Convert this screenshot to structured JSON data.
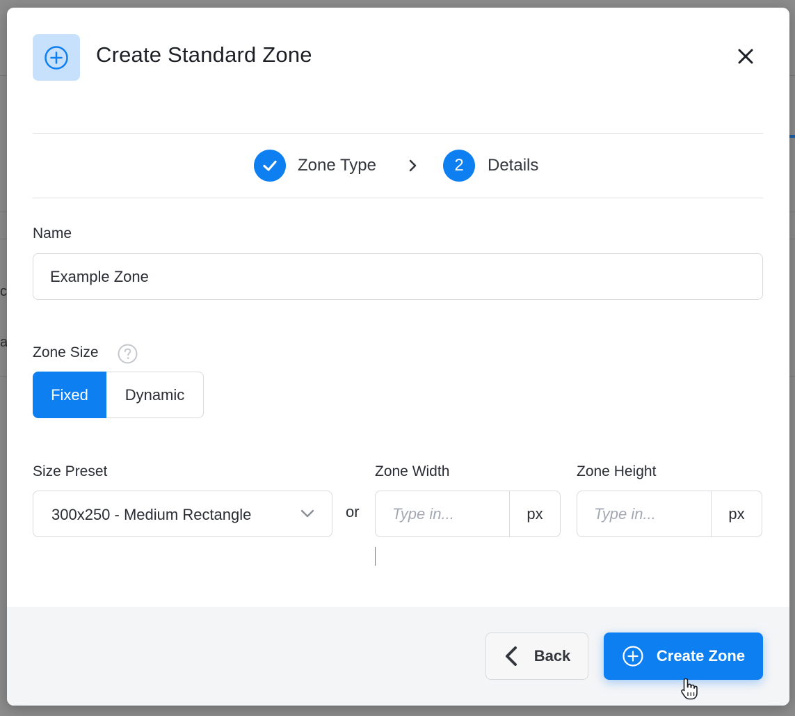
{
  "modal": {
    "title": "Create Standard Zone",
    "header_icon": "plus-circle-icon",
    "close_icon": "close-icon"
  },
  "stepper": {
    "steps": [
      {
        "label": "Zone Type",
        "state": "completed",
        "icon": "check-icon"
      },
      {
        "label": "Details",
        "state": "active",
        "number": "2"
      }
    ],
    "separator_icon": "chevron-right-icon"
  },
  "form": {
    "name_label": "Name",
    "name_value": "Example Zone",
    "zone_size_label": "Zone Size",
    "zone_size_help_icon": "question-circle-icon",
    "zone_size_options": [
      "Fixed",
      "Dynamic"
    ],
    "zone_size_selected": "Fixed",
    "size_preset_label": "Size Preset",
    "size_preset_value": "300x250 - Medium Rectangle",
    "or_text": "or",
    "zone_width_label": "Zone Width",
    "zone_width_placeholder": "Type in...",
    "zone_width_unit": "px",
    "zone_height_label": "Zone Height",
    "zone_height_placeholder": "Type in...",
    "zone_height_unit": "px"
  },
  "footer": {
    "back_label": "Back",
    "back_icon": "chevron-left-icon",
    "create_label": "Create Zone",
    "create_icon": "plus-circle-icon"
  },
  "backdrop": {
    "fragments": [
      "c",
      "a"
    ]
  },
  "colors": {
    "accent": "#0e7ff1",
    "header_icon_bg": "#c7e0fb",
    "footer_bg": "#f4f5f7",
    "overlay": "#8c8c8c"
  }
}
